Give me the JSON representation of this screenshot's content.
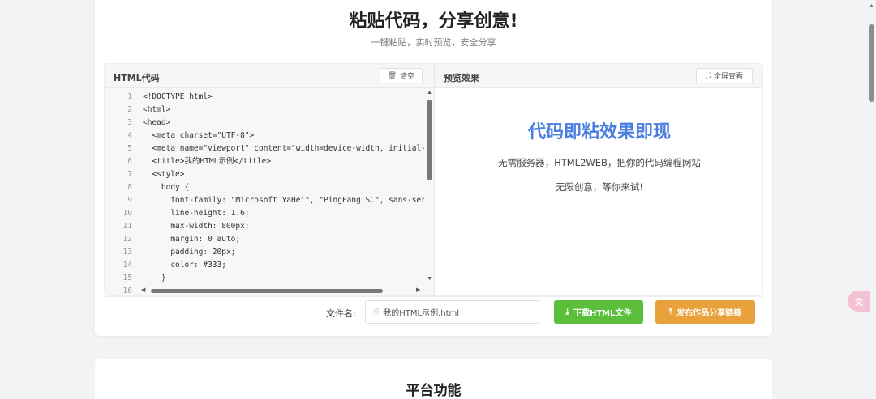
{
  "hero": {
    "title": "粘贴代码，分享创意!",
    "subtitle": "一键粘贴，实时预览，安全分享"
  },
  "editor": {
    "title": "HTML代码",
    "clear_label": "清空",
    "clear_icon": "trash-icon",
    "lines": [
      {
        "n": "1",
        "text": "<!DOCTYPE html>"
      },
      {
        "n": "2",
        "text": "<html>"
      },
      {
        "n": "3",
        "text": "<head>"
      },
      {
        "n": "4",
        "text": "  <meta charset=\"UTF-8\">"
      },
      {
        "n": "5",
        "text": "  <meta name=\"viewport\" content=\"width=device-width, initial-sca"
      },
      {
        "n": "6",
        "text": "  <title>我的HTML示例</title>"
      },
      {
        "n": "7",
        "text": "  <style>"
      },
      {
        "n": "8",
        "text": "    body {"
      },
      {
        "n": "9",
        "text": "      font-family: \"Microsoft YaHei\", \"PingFang SC\", sans-serif"
      },
      {
        "n": "10",
        "text": "      line-height: 1.6;"
      },
      {
        "n": "11",
        "text": "      max-width: 800px;"
      },
      {
        "n": "12",
        "text": "      margin: 0 auto;"
      },
      {
        "n": "13",
        "text": "      padding: 20px;"
      },
      {
        "n": "14",
        "text": "      color: #333;"
      },
      {
        "n": "15",
        "text": "    }"
      },
      {
        "n": "16",
        "text": ""
      }
    ]
  },
  "preview": {
    "title": "预览效果",
    "fullscreen_label": "全屏查看",
    "fullscreen_icon": "expand-icon",
    "heading": "代码即粘效果即现",
    "line1": "无需服务器，HTML2WEB，把你的代码编程网站",
    "line2": "无限创意，等你来试!"
  },
  "footer": {
    "filename_label": "文件名:",
    "filename_value": "我的HTML示例.html",
    "download_label": "下载HTML文件",
    "publish_label": "发布作品分享链接"
  },
  "section2": {
    "title": "平台功能"
  },
  "colors": {
    "accent_blue": "#4a7fe0",
    "download_green": "#5bbf3c",
    "publish_orange": "#e9a23b"
  }
}
